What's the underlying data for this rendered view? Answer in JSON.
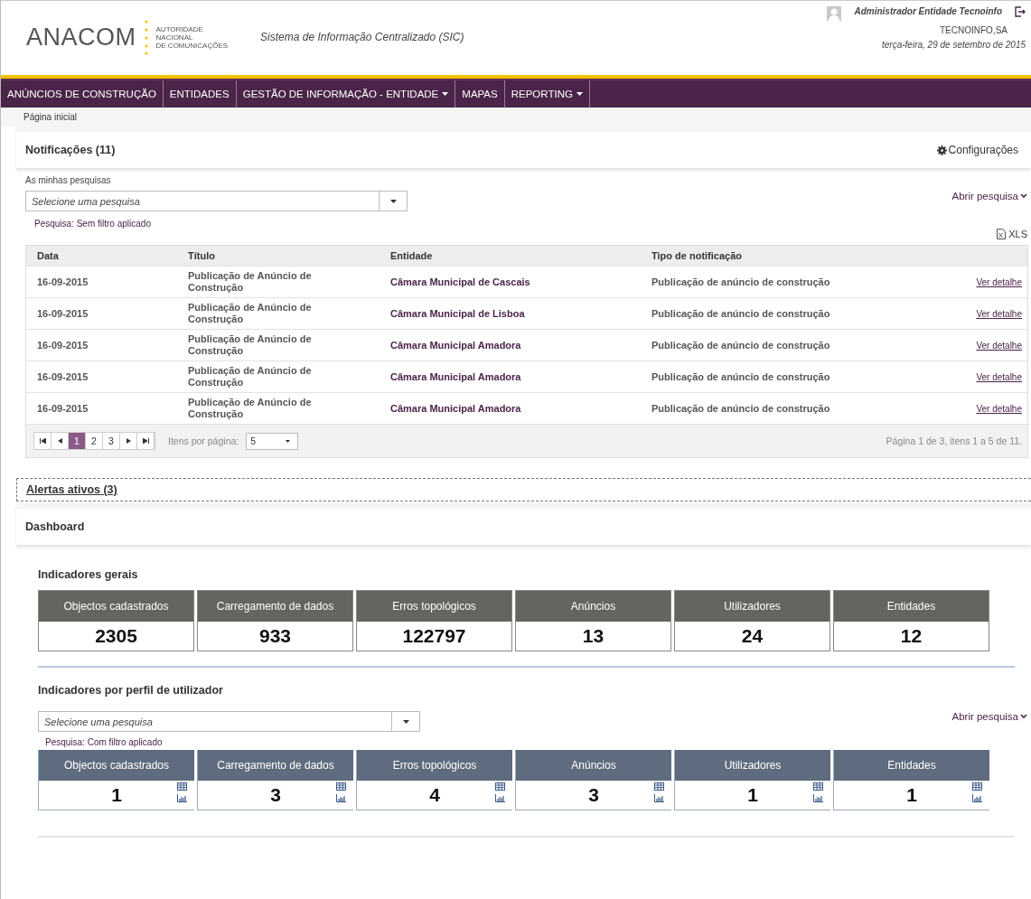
{
  "header": {
    "logo": "ANACOM",
    "logo_subtitle": [
      "AUTORIDADE",
      "NACIONAL",
      "DE COMUNICAÇÕES"
    ],
    "system_title": "Sistema de Informação Centralizado (SIC)",
    "user": "Administrador Entidade Tecnoinfo",
    "company": "TECNOINFO,SA",
    "date": "terça-feira, 29 de setembro de 2015"
  },
  "nav": [
    {
      "label": "ANÚNCIOS DE CONSTRUÇÃO",
      "dropdown": false
    },
    {
      "label": "ENTIDADES",
      "dropdown": false
    },
    {
      "label": "GESTÃO DE INFORMAÇÃO - ENTIDADE",
      "dropdown": true
    },
    {
      "label": "MAPAS",
      "dropdown": false
    },
    {
      "label": "REPORTING",
      "dropdown": true
    }
  ],
  "breadcrumb": "Página inicial",
  "notifications": {
    "title": "Notificações (11)",
    "settings": "Configurações",
    "searches_label": "As minhas pesquisas",
    "search_placeholder": "Selecione uma pesquisa",
    "open_search": "Abrir pesquisa",
    "filter_status": "Pesquisa: Sem filtro aplicado",
    "export": "XLS",
    "table": {
      "columns": [
        "Data",
        "Título",
        "Entidade",
        "Tipo de notificação"
      ],
      "rows": [
        {
          "date": "16-09-2015",
          "title": "Publicação de Anúncio de Construção",
          "entity": "Câmara Municipal de Cascais",
          "type": "Publicação de anúncio de construção",
          "link": "Ver detalhe"
        },
        {
          "date": "16-09-2015",
          "title": "Publicação de Anúncio de Construção",
          "entity": "Câmara Municipal de Lisboa",
          "type": "Publicação de anúncio de construção",
          "link": "Ver detalhe"
        },
        {
          "date": "16-09-2015",
          "title": "Publicação de Anúncio de Construção",
          "entity": "Câmara Municipal Amadora",
          "type": "Publicação de anúncio de construção",
          "link": "Ver detalhe"
        },
        {
          "date": "16-09-2015",
          "title": "Publicação de Anúncio de Construção",
          "entity": "Câmara Municipal Amadora",
          "type": "Publicação de anúncio de construção",
          "link": "Ver detalhe"
        },
        {
          "date": "16-09-2015",
          "title": "Publicação de Anúncio de Construção",
          "entity": "Câmara Municipal Amadora",
          "type": "Publicação de anúncio de construção",
          "link": "Ver detalhe"
        }
      ]
    },
    "pager": {
      "pages": [
        {
          "label": "1",
          "selected": true
        },
        {
          "label": "2",
          "selected": false
        },
        {
          "label": "3",
          "selected": false
        }
      ],
      "per_page_label": "Itens por página:",
      "per_page": "5",
      "summary": "Página 1 de 3, itens 1 a 5 de 11."
    }
  },
  "alerts": {
    "title": "Alertas ativos (3)"
  },
  "dashboard": {
    "title": "Dashboard",
    "general": {
      "title": "Indicadores gerais",
      "cards": [
        {
          "label": "Objectos cadastrados",
          "value": "2305"
        },
        {
          "label": "Carregamento de dados",
          "value": "933"
        },
        {
          "label": "Erros topológicos",
          "value": "122797"
        },
        {
          "label": "Anúncios",
          "value": "13"
        },
        {
          "label": "Utilizadores",
          "value": "24"
        },
        {
          "label": "Entidades",
          "value": "12"
        }
      ]
    },
    "profile": {
      "title": "Indicadores por perfil de utilizador",
      "search_placeholder": "Selecione uma pesquisa",
      "open_search": "Abrir pesquisa",
      "filter_status": "Pesquisa: Com filtro aplicado",
      "cards": [
        {
          "label": "Objectos cadastrados",
          "value": "1"
        },
        {
          "label": "Carregamento de dados",
          "value": "3"
        },
        {
          "label": "Erros topológicos",
          "value": "4"
        },
        {
          "label": "Anúncios",
          "value": "3"
        },
        {
          "label": "Utilizadores",
          "value": "1"
        },
        {
          "label": "Entidades",
          "value": "1"
        }
      ]
    }
  }
}
